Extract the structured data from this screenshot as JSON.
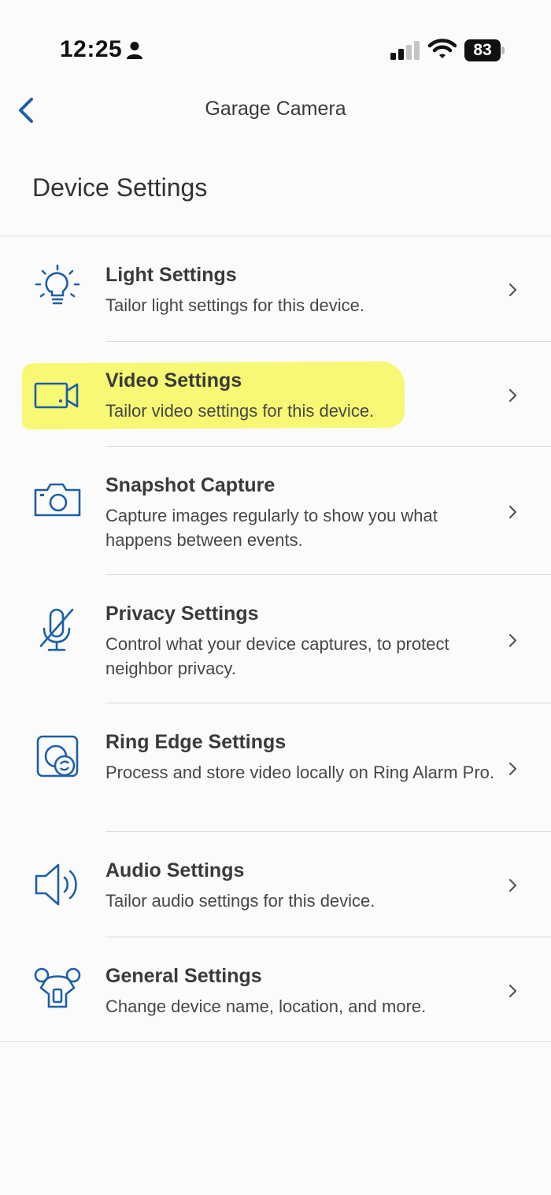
{
  "status_bar": {
    "time": "12:25",
    "battery": "83",
    "icons": [
      "person-icon",
      "cellular-signal-icon",
      "wifi-icon",
      "battery-icon"
    ]
  },
  "nav": {
    "back_icon": "chevron-left-icon",
    "title": "Garage Camera"
  },
  "section_title": "Device Settings",
  "accent_color": "#1d5fa8",
  "highlight_color": "#f6f75a",
  "settings": [
    {
      "icon": "lightbulb-icon",
      "title": "Light Settings",
      "desc": "Tailor light settings for this device."
    },
    {
      "icon": "video-camera-icon",
      "title": "Video Settings",
      "desc": "Tailor video settings for this device.",
      "highlighted": true
    },
    {
      "icon": "camera-icon",
      "title": "Snapshot Capture",
      "desc": "Capture images regularly to show you what happens between events."
    },
    {
      "icon": "muted-microphone-icon",
      "title": "Privacy Settings",
      "desc": "Control what your device captures, to protect neighbor privacy."
    },
    {
      "icon": "ring-edge-icon",
      "title": "Ring Edge Settings",
      "desc": "Process and store video locally on Ring Alarm Pro."
    },
    {
      "icon": "speaker-icon",
      "title": "Audio Settings",
      "desc": "Tailor audio settings for this device."
    },
    {
      "icon": "device-gear-icon",
      "title": "General Settings",
      "desc": "Change device name, location, and more."
    }
  ]
}
